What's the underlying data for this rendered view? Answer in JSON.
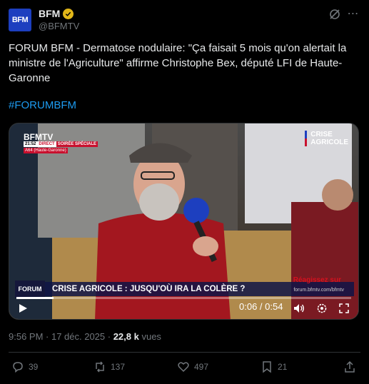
{
  "account": {
    "display_name": "BFM",
    "handle": "@BFMTV",
    "avatar_text": "BFM",
    "verified_color": "#e2b719"
  },
  "tweet": {
    "text": "FORUM BFM - Dermatose nodulaire: \"Ça faisait 5 mois qu'on alertait la ministre de l'Agriculture\" affirme Christophe Bex, député LFI de Haute-Garonne",
    "hashtag": "#FORUMBFM"
  },
  "video": {
    "channel_logo": "BFMTV",
    "broadcast_time": "21:52",
    "broadcast_status": "DIRECT",
    "broadcast_label": "SOIRÉE SPÉCIALE",
    "location": "A64 (Haute-Garonne)",
    "top_right_line1": "CRISE",
    "top_right_line2": "AGRICOLE",
    "lower_third_logo": "FORUM",
    "lower_third_title": "CRISE AGRICOLE : JUSQU'OÙ IRA LA COLÈRE  ?",
    "lower_third_red": "Réagissez sur",
    "lower_third_url": "forum.bfmtv.com/bfmtv",
    "elapsed": "0:06",
    "duration": "0:54",
    "time_display": "0:06 / 0:54",
    "progress_fraction": 0.11
  },
  "meta": {
    "timestamp": "9:56 PM · 17 déc. 2025 · ",
    "views_count": "22,8 k",
    "views_label": " vues"
  },
  "actions": {
    "replies": "39",
    "reposts": "137",
    "likes": "497",
    "bookmarks": "21"
  },
  "colors": {
    "accent": "#1d9bf0",
    "muted": "#71767b",
    "text": "#e7e9ea",
    "background": "#000000"
  }
}
